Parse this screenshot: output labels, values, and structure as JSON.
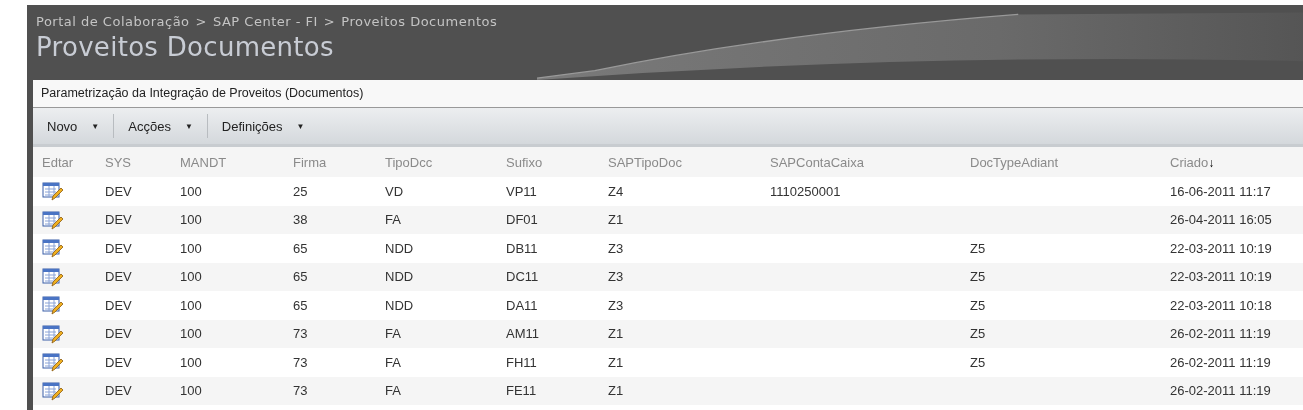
{
  "breadcrumb": [
    "Portal de Colaboração",
    ">",
    "SAP Center - FI",
    ">",
    "Proveitos Documentos"
  ],
  "page_title": "Proveitos Documentos",
  "list_description": "Parametrização da Integração de Proveitos (Documentos)",
  "toolbar": [
    {
      "label": "Novo",
      "caret": "▼"
    },
    {
      "label": "Acções",
      "caret": "▼"
    },
    {
      "label": "Definições",
      "caret": "▼"
    }
  ],
  "table": {
    "columns": [
      {
        "label": "Edtar"
      },
      {
        "label": "SYS"
      },
      {
        "label": "MANDT"
      },
      {
        "label": "Firma"
      },
      {
        "label": "TipoDcc"
      },
      {
        "label": "Sufixo"
      },
      {
        "label": "SAPTipoDoc"
      },
      {
        "label": "SAPContaCaixa"
      },
      {
        "label": "DocTypeAdiant"
      },
      {
        "label": "Criado",
        "sort_arrow": "↓"
      }
    ],
    "rows": [
      [
        "",
        "DEV",
        "100",
        "25",
        "VD",
        "VP11",
        "Z4",
        "1110250001",
        "",
        "16-06-2011 11:17"
      ],
      [
        "",
        "DEV",
        "100",
        "38",
        "FA",
        "DF01",
        "Z1",
        "",
        "",
        "26-04-2011 16:05"
      ],
      [
        "",
        "DEV",
        "100",
        "65",
        "NDD",
        "DB11",
        "Z3",
        "",
        "Z5",
        "22-03-2011 10:19"
      ],
      [
        "",
        "DEV",
        "100",
        "65",
        "NDD",
        "DC11",
        "Z3",
        "",
        "Z5",
        "22-03-2011 10:19"
      ],
      [
        "",
        "DEV",
        "100",
        "65",
        "NDD",
        "DA11",
        "Z3",
        "",
        "Z5",
        "22-03-2011 10:18"
      ],
      [
        "",
        "DEV",
        "100",
        "73",
        "FA",
        "AM11",
        "Z1",
        "",
        "Z5",
        "26-02-2011 11:19"
      ],
      [
        "",
        "DEV",
        "100",
        "73",
        "FA",
        "FH11",
        "Z1",
        "",
        "Z5",
        "26-02-2011 11:19"
      ],
      [
        "",
        "DEV",
        "100",
        "73",
        "FA",
        "FE11",
        "Z1",
        "",
        "",
        "26-02-2011 11:19"
      ]
    ]
  }
}
